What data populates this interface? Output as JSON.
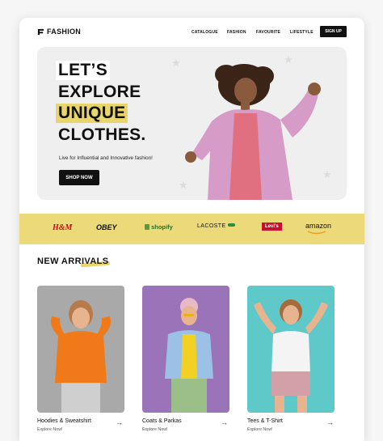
{
  "brand": {
    "name": "FASHION",
    "icon": "f-logo-icon"
  },
  "nav": {
    "items": [
      "CATALOGUE",
      "FASHION",
      "FAVOURITE",
      "LIFESTYLE"
    ],
    "signup": "SIGN UP"
  },
  "hero": {
    "lines": [
      "LET’S",
      "EXPLORE",
      "UNIQUE",
      "CLOTHES."
    ],
    "tagline": "Live for Influential and Innovative fashion!",
    "cta": "SHOP NOW"
  },
  "brands": [
    "H&M",
    "OBEY",
    "shopify",
    "LACOSTE",
    "Levi's",
    "amazon"
  ],
  "arrivals": {
    "title": "NEW ARRIVALS",
    "cards": [
      {
        "title": "Hoodies & Sweatshirt",
        "sub": "Explore Now!",
        "bg": "#a9a9a9",
        "accent": "#f07a1a"
      },
      {
        "title": "Coats & Parkas",
        "sub": "Explore Now!",
        "bg": "#9a73b8",
        "accent": "#9bc2e6"
      },
      {
        "title": "Tees & T-Shirt",
        "sub": "Explore Now!",
        "bg": "#5fc9c9",
        "accent": "#f4f4f4"
      }
    ]
  },
  "colors": {
    "accent": "#e8d56d",
    "dark": "#111111"
  }
}
